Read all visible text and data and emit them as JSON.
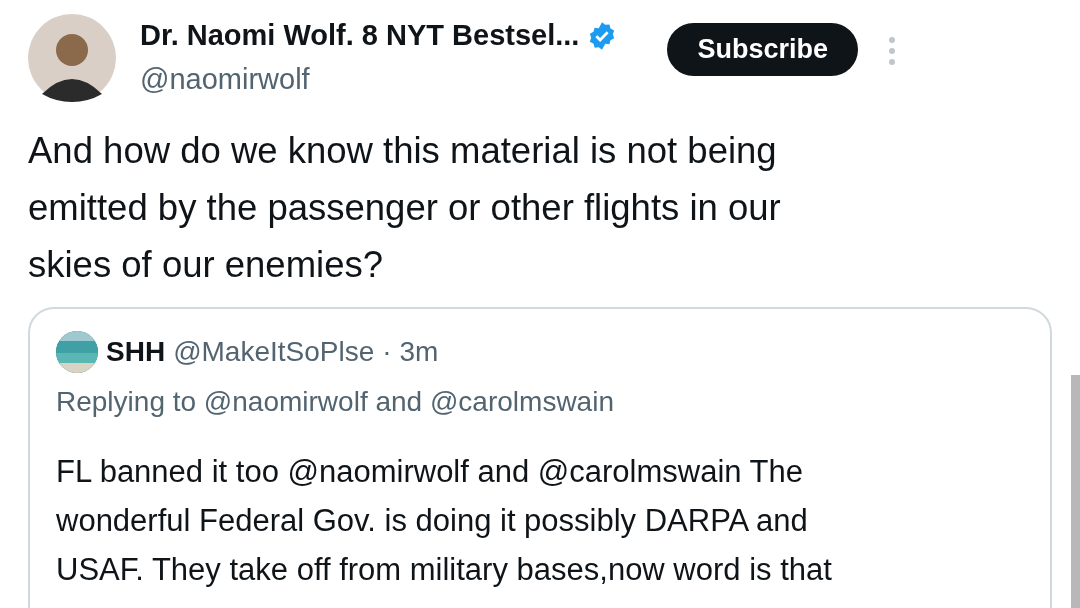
{
  "author": {
    "name": "Dr. Naomi Wolf. 8 NYT Bestsel...",
    "verified": true,
    "handle": "@naomirwolf"
  },
  "subscribe_button": "Subscribe",
  "tweet_text": [
    "And how do we know this material is not being",
    "emitted by the passenger or other flights  in our",
    "skies of our enemies?"
  ],
  "quoted_tweet": {
    "name": "SHH",
    "handle": "@MakeItSoPlse",
    "time": "· 3m",
    "replying_to": "Replying to @naomirwolf and @carolmswain",
    "text": [
      "FL banned it too @naomirwolf and @carolmswain The",
      "wonderful Federal Gov. is doing it possibly  DARPA and",
      "USAF. They take off from military bases,now word is that"
    ]
  }
}
